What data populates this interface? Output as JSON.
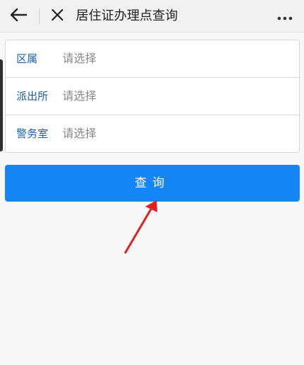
{
  "header": {
    "title": "居住证办理点查询",
    "back_icon": "arrow-left-icon",
    "close_icon": "close-icon",
    "more_icon": "more-horizontal-icon"
  },
  "form": {
    "rows": [
      {
        "label": "区属",
        "placeholder": "请选择"
      },
      {
        "label": "派出所",
        "placeholder": "请选择"
      },
      {
        "label": "警务室",
        "placeholder": "请选择"
      }
    ]
  },
  "actions": {
    "query_label": "查询"
  },
  "colors": {
    "accent": "#1685f5",
    "label": "#1a62a6",
    "annotation_arrow": "#e0201f"
  }
}
